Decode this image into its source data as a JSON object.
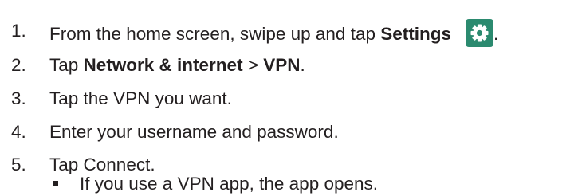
{
  "steps": [
    {
      "number": "1.",
      "text_before": "From the home screen, swipe up and tap ",
      "bold": "Settings",
      "icon": "settings-gear-icon",
      "text_after": "."
    },
    {
      "number": "2.",
      "text_before": "Tap ",
      "bold": "Network & internet",
      "separator": " > ",
      "bold2": "VPN",
      "text_after": "."
    },
    {
      "number": "3.",
      "text": "Tap the VPN you want."
    },
    {
      "number": "4.",
      "text": "Enter your username and password."
    },
    {
      "number": "5.",
      "text": "Tap Connect.",
      "sub_items": [
        "If you use a VPN app, the app opens."
      ]
    }
  ],
  "colors": {
    "text": "#231f20",
    "icon_background": "#2b8a6f",
    "icon_foreground": "#ffffff"
  }
}
